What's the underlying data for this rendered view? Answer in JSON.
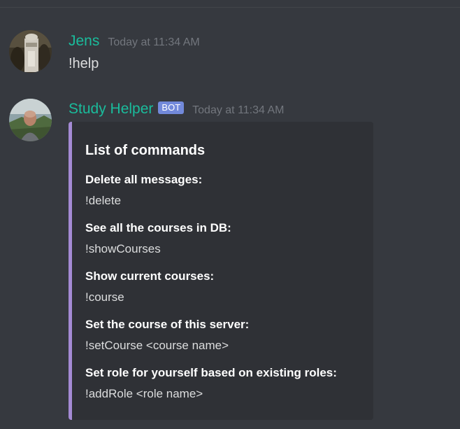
{
  "messages": [
    {
      "username": "Jens",
      "timestamp": "Today at 11:34 AM",
      "content": "!help"
    },
    {
      "username": "Study Helper",
      "bot_tag": "BOT",
      "timestamp": "Today at 11:34 AM",
      "embed": {
        "title": "List of commands",
        "accent_color": "#a48ad4",
        "fields": [
          {
            "name": "Delete all messages:",
            "value": "!delete"
          },
          {
            "name": "See all the courses in DB:",
            "value": "!showCourses"
          },
          {
            "name": "Show current courses:",
            "value": "!course"
          },
          {
            "name": "Set the course of this server:",
            "value": "!setCourse <course name>"
          },
          {
            "name": "Set role for yourself based on existing roles:",
            "value": "!addRole <role name>"
          }
        ]
      }
    }
  ],
  "colors": {
    "background": "#36393f",
    "username": "#1abc9c",
    "bot_tag": "#7289da",
    "embed_background": "#2f3136"
  }
}
